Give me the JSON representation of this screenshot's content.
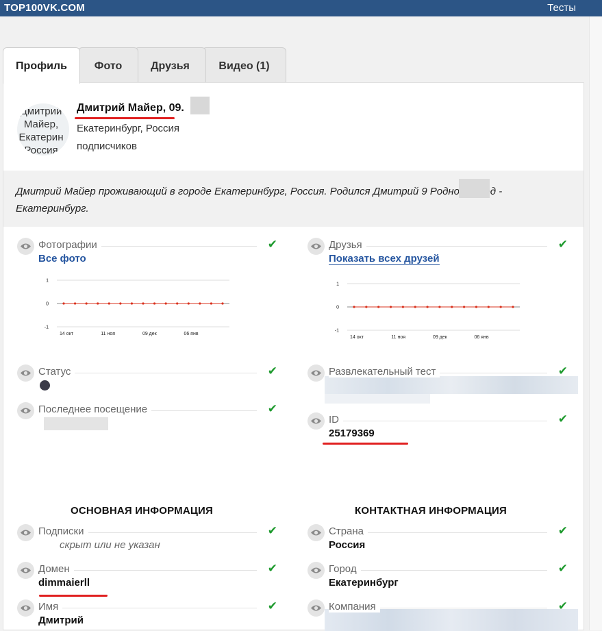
{
  "header": {
    "brand": "TOP100VK.COM",
    "tests_link": "Тесты"
  },
  "tabs": [
    {
      "label": "Профиль",
      "active": true
    },
    {
      "label": "Фото",
      "active": false
    },
    {
      "label": "Друзья",
      "active": false
    },
    {
      "label": "Видео (1)",
      "active": false
    }
  ],
  "profile": {
    "avatar_text": [
      "Дмитрий",
      "Майер,",
      "Екатерин",
      "Россия"
    ],
    "name": "Дмитрий Майер, 09.",
    "location": "Екатеринбург, Россия",
    "subscribers": "подписчиков",
    "description": "Дмитрий Майер проживающий в городе Екатеринбург, Россия. Родился Дмитрий 9 Родной город - Екатеринбург."
  },
  "fields": {
    "photos": {
      "label": "Фотографии",
      "link": "Все фото"
    },
    "friends": {
      "label": "Друзья",
      "link": "Показать всех друзей"
    },
    "status": {
      "label": "Статус"
    },
    "entertainment_test": {
      "label": "Развлекательный тест"
    },
    "last_visit": {
      "label": "Последнее посещение"
    },
    "id": {
      "label": "ID",
      "value": "25179369"
    },
    "subscriptions": {
      "label": "Подписки",
      "value": "скрыт или не указан"
    },
    "country": {
      "label": "Страна",
      "value": "Россия"
    },
    "domain": {
      "label": "Домен",
      "value": "dimmaierll"
    },
    "city": {
      "label": "Город",
      "value": "Екатеринбург"
    },
    "first_name": {
      "label": "Имя",
      "value": "Дмитрий"
    },
    "company": {
      "label": "Компания"
    }
  },
  "sections": {
    "main_info": "ОСНОВНАЯ ИНФОРМАЦИЯ",
    "contact_info": "КОНТАКТНАЯ ИНФОРМАЦИЯ"
  },
  "icons": {
    "eye": "eye-icon",
    "check": "check-icon"
  },
  "colors": {
    "header_bg": "#2c5586",
    "link": "#2656a0",
    "check": "#1e9a2e",
    "highlight": "#e02020",
    "chart_line": "#d9331f"
  },
  "chart_data": [
    {
      "type": "line",
      "title": "",
      "x_ticks": [
        "14 окт",
        "11 ноя",
        "09 дек",
        "06 янв"
      ],
      "y_ticks": [
        1,
        0,
        -1
      ],
      "ylim": [
        -1,
        1
      ],
      "series": [
        {
          "values": [
            0,
            0,
            0,
            0,
            0,
            0,
            0,
            0,
            0,
            0,
            0,
            0,
            0,
            0,
            0
          ]
        }
      ]
    },
    {
      "type": "line",
      "title": "",
      "x_ticks": [
        "14 окт",
        "11 ноя",
        "09 дек",
        "06 янв"
      ],
      "y_ticks": [
        1,
        0,
        -1
      ],
      "ylim": [
        -1,
        1
      ],
      "series": [
        {
          "values": [
            0,
            0,
            0,
            0,
            0,
            0,
            0,
            0,
            0,
            0,
            0,
            0,
            0,
            0
          ]
        }
      ]
    }
  ]
}
